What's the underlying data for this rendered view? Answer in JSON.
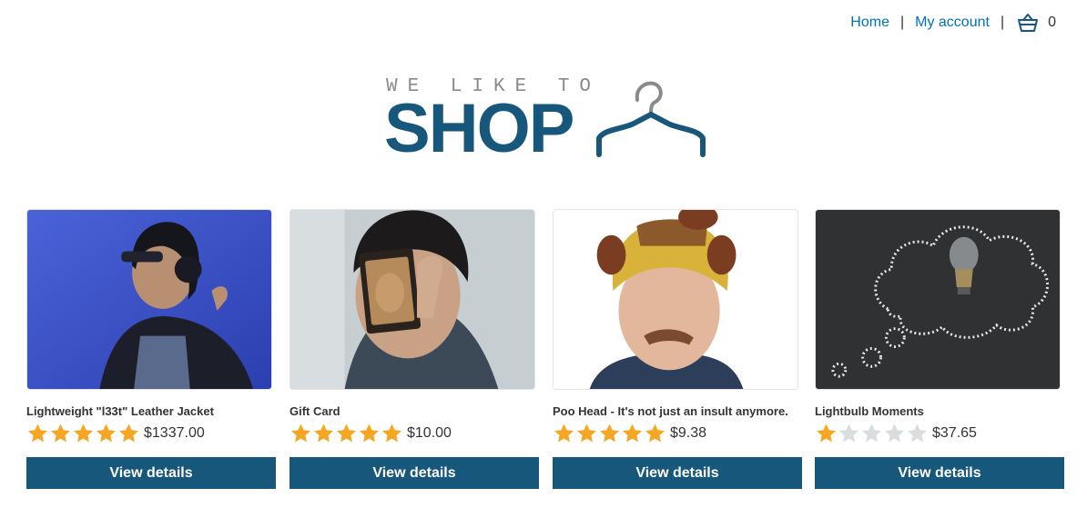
{
  "nav": {
    "home_label": "Home",
    "separator": "|",
    "account_label": "My account",
    "cart_count": "0"
  },
  "logo": {
    "tagline": "WE LIKE TO",
    "wordmark": "SHOP"
  },
  "products": [
    {
      "name": "Lightweight \"l33t\" Leather Jacket",
      "rating": 5,
      "price": "$1337.00",
      "button_label": "View details",
      "image": "woman-headphones-photo"
    },
    {
      "name": "Gift Card",
      "rating": 5,
      "price": "$10.00",
      "button_label": "View details",
      "image": "person-holding-card-photo"
    },
    {
      "name": "Poo Head - It's not just an insult anymore.",
      "rating": 5,
      "price": "$9.38",
      "button_label": "View details",
      "image": "man-novelty-hat-photo"
    },
    {
      "name": "Lightbulb Moments",
      "rating": 1,
      "price": "$37.65",
      "button_label": "View details",
      "image": "chalkboard-lightbulb-photo"
    }
  ],
  "colors": {
    "link": "#0071bc",
    "brand": "#17577c",
    "star_filled": "#f5a623",
    "star_empty": "#d9dde0"
  }
}
